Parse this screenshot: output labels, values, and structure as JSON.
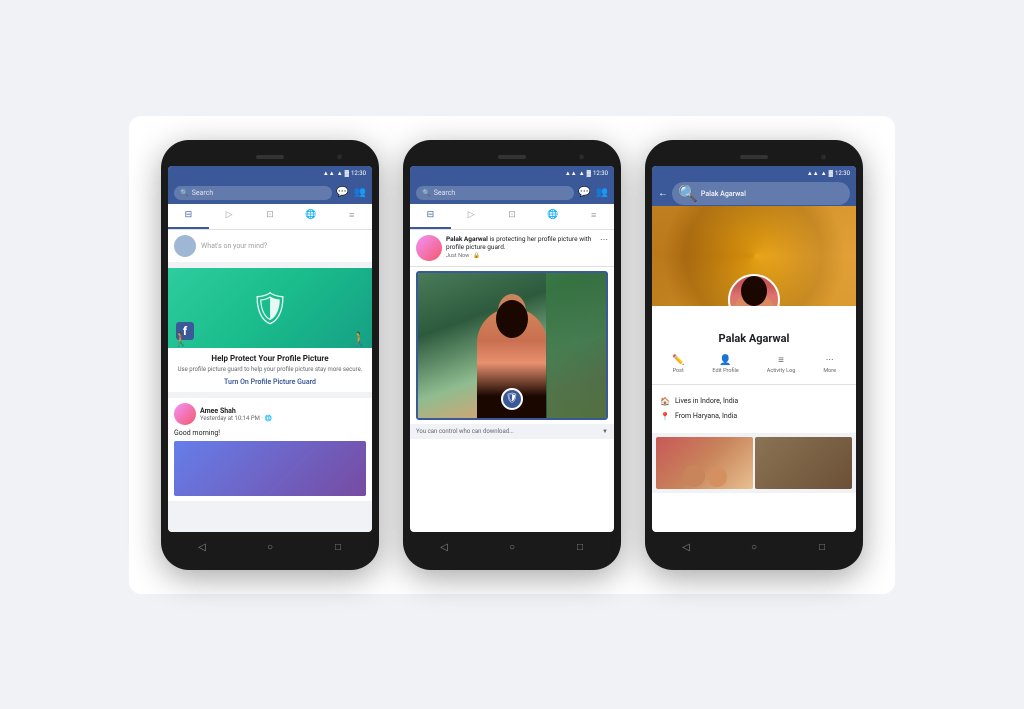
{
  "background": "#f0f2f5",
  "phones": [
    {
      "id": "phone1",
      "statusBar": {
        "time": "12:30",
        "signal": "▲▲",
        "wifi": "▲",
        "battery": "▓"
      },
      "searchPlaceholder": "Search",
      "navIcons": [
        "⊟",
        "▷",
        "⊡",
        "🌐",
        "≡"
      ],
      "composerPlaceholder": "What's on your mind?",
      "protectCard": {
        "title": "Help Protect Your Profile Picture",
        "description": "Use profile picture guard to help your profile picture stay more secure.",
        "cta": "Turn On Profile Picture Guard"
      },
      "post": {
        "author": "Amee Shah",
        "time": "Yesterday at 10:14 PM · 🌐",
        "text": "Good morning!"
      },
      "bottomNav": [
        "◁",
        "○",
        "□"
      ]
    },
    {
      "id": "phone2",
      "statusBar": {
        "time": "12:30"
      },
      "searchPlaceholder": "Search",
      "notification": {
        "name": "Palak Agarwal",
        "action": "is protecting her profile picture with profile picture guard.",
        "time": "Just Now · 🔒"
      },
      "downloadText": "You can control who can download...",
      "bottomNav": [
        "◁",
        "○",
        "□"
      ]
    },
    {
      "id": "phone3",
      "statusBar": {
        "time": "12:30"
      },
      "profileName": "Palak Agarwal",
      "searchText": "Palak Agarwal",
      "actions": [
        {
          "icon": "✏",
          "label": "Post"
        },
        {
          "icon": "👤",
          "label": "Edit Profile"
        },
        {
          "icon": "≡",
          "label": "Activity Log"
        },
        {
          "icon": "•••",
          "label": "More"
        }
      ],
      "details": [
        {
          "icon": "🏠",
          "text": "Lives in Indore, India"
        },
        {
          "icon": "📍",
          "text": "From Haryana, India"
        }
      ],
      "bottomNav": [
        "◁",
        "○",
        "□"
      ]
    }
  ]
}
